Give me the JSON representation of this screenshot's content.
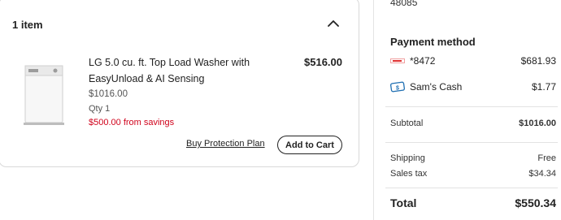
{
  "cart": {
    "header": "1 item",
    "item": {
      "title": "LG 5.0 cu. ft. Top Load Washer with EasyUnload & AI Sensing",
      "original_price": "$1016.00",
      "qty": "Qty 1",
      "savings": "$500.00 from savings",
      "price": "$516.00",
      "protection_link": "Buy Protection Plan",
      "add_to_cart": "Add to Cart"
    }
  },
  "summary": {
    "zip": "48085",
    "payment_title": "Payment method",
    "card_label": "*8472",
    "card_amount": "$681.93",
    "cash_label": "Sam's Cash",
    "cash_amount": "$1.77",
    "subtotal_label": "Subtotal",
    "subtotal_value": "$1016.00",
    "shipping_label": "Shipping",
    "shipping_value": "Free",
    "tax_label": "Sales tax",
    "tax_value": "$34.34",
    "total_label": "Total",
    "total_value": "$550.34"
  },
  "icons": {
    "collapse": "chevron-up-icon",
    "card": "credit-card-icon",
    "cash": "sams-cash-icon"
  },
  "colors": {
    "savings": "#d0021b",
    "cash_icon": "#1f6fb2"
  }
}
